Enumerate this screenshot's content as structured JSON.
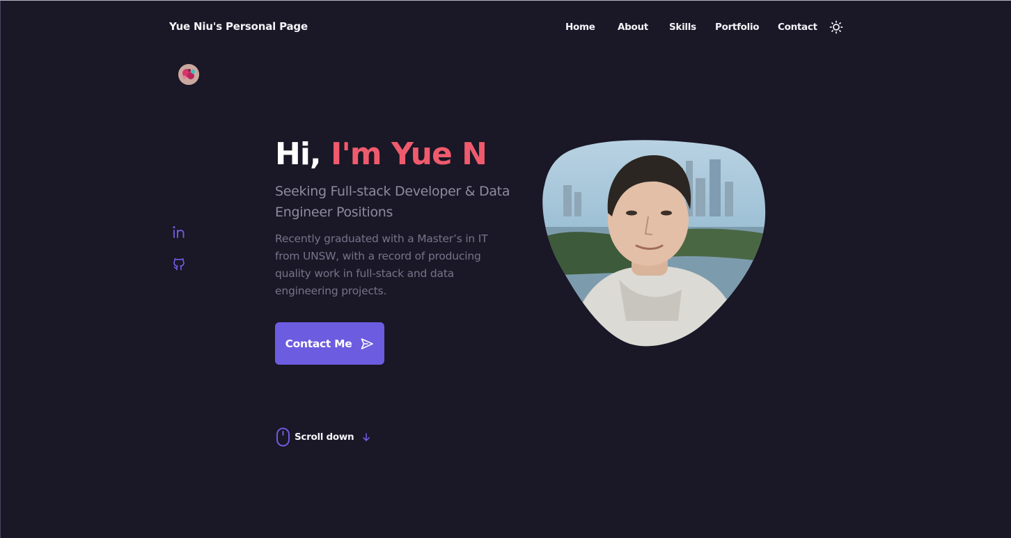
{
  "header": {
    "brand": "Yue Niu's Personal Page",
    "nav": [
      {
        "label": "Home"
      },
      {
        "label": "About"
      },
      {
        "label": "Skills"
      },
      {
        "label": "Portfolio"
      },
      {
        "label": "Contact"
      }
    ],
    "theme_toggle_icon": "sun-icon"
  },
  "avatar_icon": "profile-avatar",
  "social": [
    {
      "icon": "linkedin-icon"
    },
    {
      "icon": "github-icon"
    }
  ],
  "hero": {
    "greeting": "Hi, ",
    "name": "I'm Yue N",
    "subtitle": "Seeking Full-stack Developer & Data Engineer Positions",
    "description": "Recently graduated with a Master’s in IT from UNSW, with a record of producing quality work in full-stack and data engineering projects.",
    "cta_label": "Contact Me",
    "cta_icon": "send-icon",
    "scroll_label": "Scroll down",
    "scroll_icon": "mouse-icon",
    "arrow_icon": "arrow-down-icon"
  },
  "photo": {
    "icon": "profile-photo"
  },
  "colors": {
    "background": "#1a1726",
    "accent": "#6c5ce0",
    "name_highlight": "#ef5b6d",
    "text_muted": "#8e8b9f"
  }
}
